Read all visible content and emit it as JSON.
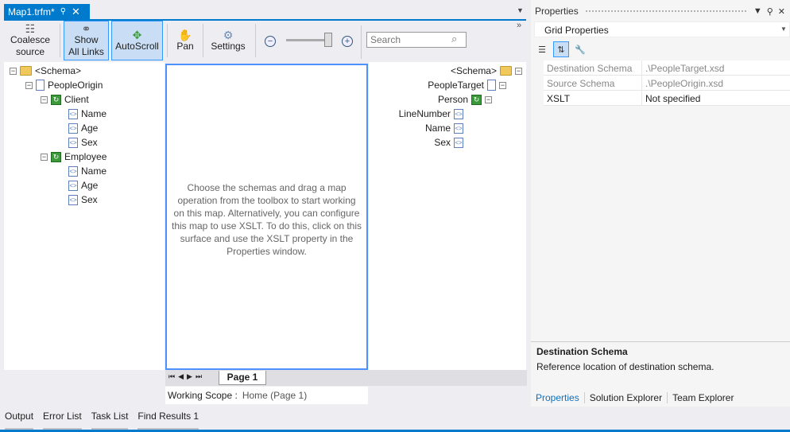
{
  "document": {
    "tab_label": "Map1.trfm*",
    "pin_icon": "pin-icon",
    "close_icon": "close-icon"
  },
  "toolbar": {
    "coalesce_line1": "Coalesce",
    "coalesce_line2": "source",
    "show_line1": "Show",
    "show_line2": "All Links",
    "autoscroll": "AutoScroll",
    "pan": "Pan",
    "settings": "Settings",
    "search_placeholder": "Search"
  },
  "left_tree": {
    "schema": "<Schema>",
    "root": "PeopleOrigin",
    "client": "Client",
    "client_fields": [
      "Name",
      "Age",
      "Sex"
    ],
    "employee": "Employee",
    "employee_fields": [
      "Name",
      "Age",
      "Sex"
    ]
  },
  "center": {
    "message": "Choose the schemas and drag a map operation from the toolbox to start working on this map. Alternatively, you can configure this map to use XSLT. To do this, click on this surface and use the XSLT property in the Properties window."
  },
  "right_tree": {
    "schema": "<Schema>",
    "root": "PeopleTarget",
    "record": "Person",
    "fields": [
      "LineNumber",
      "Name",
      "Sex"
    ]
  },
  "page": {
    "tab": "Page 1",
    "scope_label": "Working Scope :",
    "scope_value": "Home (Page 1)"
  },
  "bottom_tabs": [
    "Output",
    "Error List",
    "Task List",
    "Find Results 1"
  ],
  "properties": {
    "title": "Properties",
    "object": "Grid Properties",
    "rows": [
      {
        "name": "Destination Schema",
        "value": ".\\PeopleTarget.xsd"
      },
      {
        "name": "Source Schema",
        "value": ".\\PeopleOrigin.xsd"
      },
      {
        "name": "XSLT",
        "value": "Not specified"
      }
    ],
    "desc_title": "Destination Schema",
    "desc_text": "Reference location of destination schema.",
    "tabs": [
      "Properties",
      "Solution Explorer",
      "Team Explorer"
    ]
  },
  "colors": {
    "accent": "#007acc",
    "active_button": "#c9def5",
    "selection_border": "#4d90fe"
  }
}
